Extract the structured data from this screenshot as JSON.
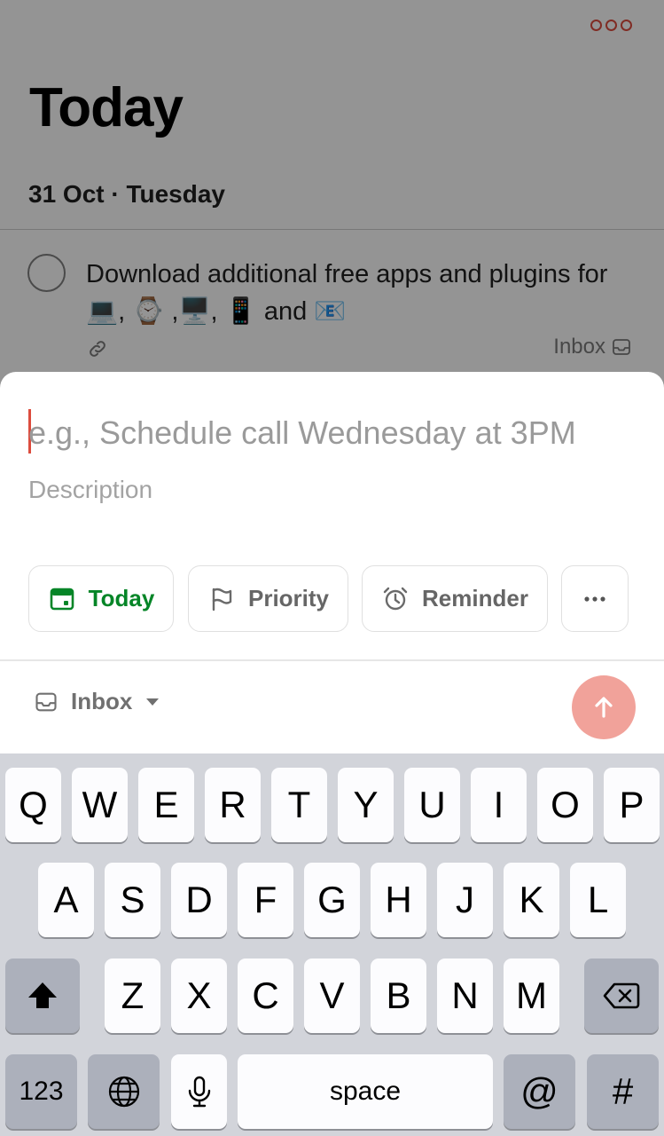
{
  "header": {
    "title": "Today",
    "date": "31 Oct · Tuesday",
    "more_icon": "more-horizontal-circles-icon"
  },
  "task": {
    "text": "Download additional free apps and plugins for 💻, ⌚️ ,🖥️, 📱 and 📧",
    "project": "Inbox",
    "link_icon": "link-icon"
  },
  "quick_add": {
    "title_placeholder": "e.g., Schedule call Wednesday at 3PM",
    "description_placeholder": "Description",
    "chips": {
      "today": "Today",
      "priority": "Priority",
      "reminder": "Reminder"
    },
    "project": "Inbox"
  },
  "colors": {
    "accent": "#dc4c3e",
    "today_green": "#058527",
    "submit_disabled": "#f1a29a"
  },
  "keyboard": {
    "row1": [
      "Q",
      "W",
      "E",
      "R",
      "T",
      "Y",
      "U",
      "I",
      "O",
      "P"
    ],
    "row2": [
      "A",
      "S",
      "D",
      "F",
      "G",
      "H",
      "J",
      "K",
      "L"
    ],
    "row3": [
      "Z",
      "X",
      "C",
      "V",
      "B",
      "N",
      "M"
    ],
    "numbers_label": "123",
    "space_label": "space",
    "at_label": "@",
    "hash_label": "#"
  }
}
